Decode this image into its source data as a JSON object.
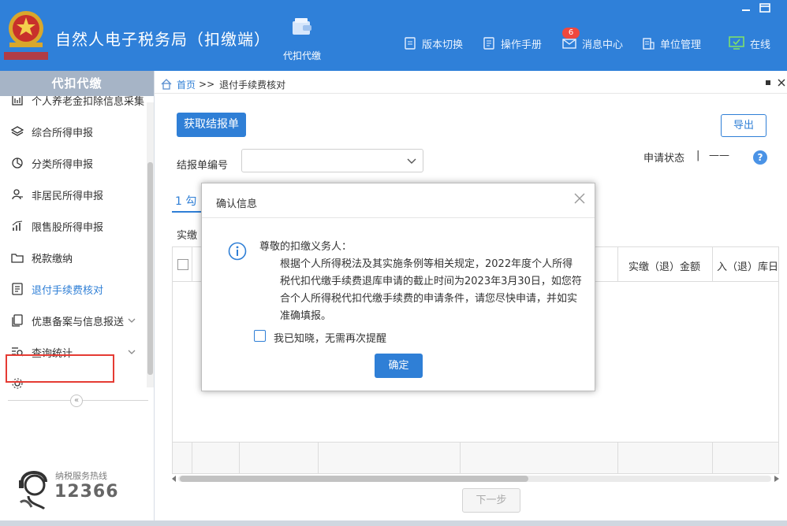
{
  "titlebar": {
    "app_title": "自然人电子税务局（扣缴端）",
    "main_nav_label": "代扣代缴",
    "nav": {
      "version_switch": "版本切换",
      "manual": "操作手册",
      "messages": "消息中心",
      "messages_badge": "6",
      "unit_mgmt": "单位管理",
      "online": "在线"
    },
    "accent_color": "#2f80d9"
  },
  "sidebar": {
    "header": "代扣代缴",
    "items": [
      {
        "label": "个人养老金扣除信息采集"
      },
      {
        "label": "综合所得申报"
      },
      {
        "label": "分类所得申报"
      },
      {
        "label": "非居民所得申报"
      },
      {
        "label": "限售股所得申报"
      },
      {
        "label": "税款缴纳"
      },
      {
        "label": "退付手续费核对"
      },
      {
        "label": "优惠备案与信息报送"
      },
      {
        "label": "查询统计"
      }
    ],
    "active_index": 6,
    "collapse_glyph": "«",
    "hotline_label": "纳税服务热线",
    "hotline_number": "12366"
  },
  "breadcrumb": {
    "home": "首页",
    "separator": ">>",
    "current": "退付手续费核对"
  },
  "toolbar": {
    "fetch_button": "获取结报单",
    "export_button": "导出"
  },
  "filters": {
    "settlement_no_label": "结报单编号",
    "settlement_no_value": "",
    "status_label": "申请状态",
    "status_separator": "|",
    "status_value": "——",
    "help_glyph": "?"
  },
  "tabs": {
    "tab1": "1 勾"
  },
  "paid_label": "实缴",
  "table": {
    "columns": [
      "实缴（退）金额",
      "入（退）库日"
    ]
  },
  "next_button": "下一步",
  "dialog": {
    "title": "确认信息",
    "greeting": "尊敬的扣缴义务人：",
    "body": "根据个人所得税法及其实施条例等相关规定，2022年度个人所得税代扣代缴手续费退库申请的截止时间为2023年3月30日，如您符合个人所得税代扣代缴手续费的申请条件，请您尽快申请，并如实准确填报。",
    "checkbox_label": "我已知晓，无需再次提醒",
    "checkbox_checked": false,
    "ok_button": "确定"
  }
}
